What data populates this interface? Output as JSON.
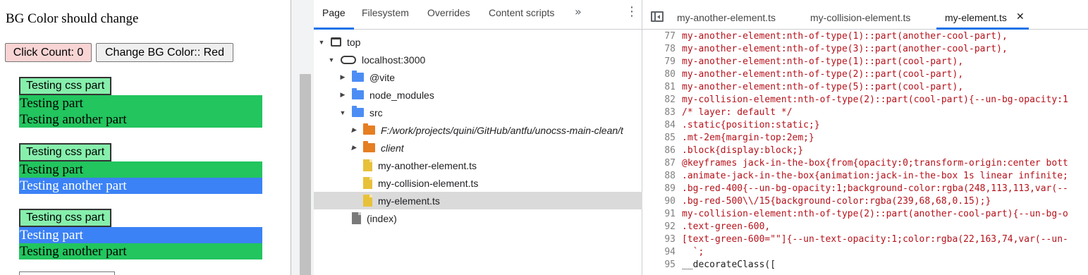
{
  "demo": {
    "heading": "BG Color should change",
    "click_count_label": "Click Count: 0",
    "change_bg_label": "Change BG Color:: Red",
    "groups": [
      {
        "button": "Testing css part",
        "part": "Testing part",
        "another_part": "Testing another part"
      },
      {
        "button": "Testing css part",
        "part": "Testing part",
        "another_part": "Testing another part"
      },
      {
        "button": "Testing css part",
        "part": "Testing part",
        "another_part": "Testing another part"
      }
    ],
    "colors": {
      "green": "#22c55e",
      "blue": "#3b82f6",
      "button_green": "#86efac",
      "count_button": "#f8d5d4"
    }
  },
  "navigator": {
    "tabs": [
      "Page",
      "Filesystem",
      "Overrides",
      "Content scripts"
    ],
    "more_icon": "chevron-double-right-icon",
    "menu_icon": "kebab-menu-icon",
    "tree": [
      {
        "label": "top",
        "icon": "frame-icon"
      },
      {
        "label": "localhost:3000",
        "icon": "cloud-icon"
      },
      {
        "label": "@vite",
        "icon": "folder-icon"
      },
      {
        "label": "node_modules",
        "icon": "folder-icon"
      },
      {
        "label": "src",
        "icon": "folder-icon"
      },
      {
        "label": "F:/work/projects/quini/GitHub/antfu/unocss-main-clean/t",
        "icon": "folder-icon"
      },
      {
        "label": "client",
        "icon": "folder-icon"
      },
      {
        "label": "my-another-element.ts",
        "icon": "file-icon"
      },
      {
        "label": "my-collision-element.ts",
        "icon": "file-icon"
      },
      {
        "label": "my-element.ts",
        "icon": "file-icon",
        "selected": true
      },
      {
        "label": "(index)",
        "icon": "file-icon"
      }
    ]
  },
  "editor": {
    "tabs": [
      "my-another-element.ts",
      "my-collision-element.ts",
      "my-element.ts"
    ],
    "active_tab": "my-element.ts",
    "close_icon": "close-icon",
    "lines": [
      {
        "n": "77",
        "code": "my-another-element:nth-of-type(1)::part(another-cool-part),"
      },
      {
        "n": "78",
        "code": "my-another-element:nth-of-type(3)::part(another-cool-part),"
      },
      {
        "n": "79",
        "code": "my-another-element:nth-of-type(1)::part(cool-part),"
      },
      {
        "n": "80",
        "code": "my-another-element:nth-of-type(2)::part(cool-part),"
      },
      {
        "n": "81",
        "code": "my-another-element:nth-of-type(5)::part(cool-part),"
      },
      {
        "n": "82",
        "code": "my-collision-element:nth-of-type(2)::part(cool-part){--un-bg-opacity:1"
      },
      {
        "n": "83",
        "code": "/* layer: default */"
      },
      {
        "n": "84",
        "code": ".static{position:static;}"
      },
      {
        "n": "85",
        "code": ".mt-2em{margin-top:2em;}"
      },
      {
        "n": "86",
        "code": ".block{display:block;}"
      },
      {
        "n": "87",
        "code": "@keyframes jack-in-the-box{from{opacity:0;transform-origin:center bott"
      },
      {
        "n": "88",
        "code": ".animate-jack-in-the-box{animation:jack-in-the-box 1s linear infinite;"
      },
      {
        "n": "89",
        "code": ".bg-red-400{--un-bg-opacity:1;background-color:rgba(248,113,113,var(--"
      },
      {
        "n": "90",
        "code": ".bg-red-500\\\\/15{background-color:rgba(239,68,68,0.15);}"
      },
      {
        "n": "91",
        "code": "my-collision-element:nth-of-type(2)::part(another-cool-part){--un-bg-o"
      },
      {
        "n": "92",
        "code": ".text-green-600,"
      },
      {
        "n": "93",
        "code": "[text-green-600=\"\"]{--un-text-opacity:1;color:rgba(22,163,74,var(--un-"
      },
      {
        "n": "94",
        "code": "  `;"
      },
      {
        "n": "95",
        "code": "__decorateClass(["
      }
    ]
  }
}
